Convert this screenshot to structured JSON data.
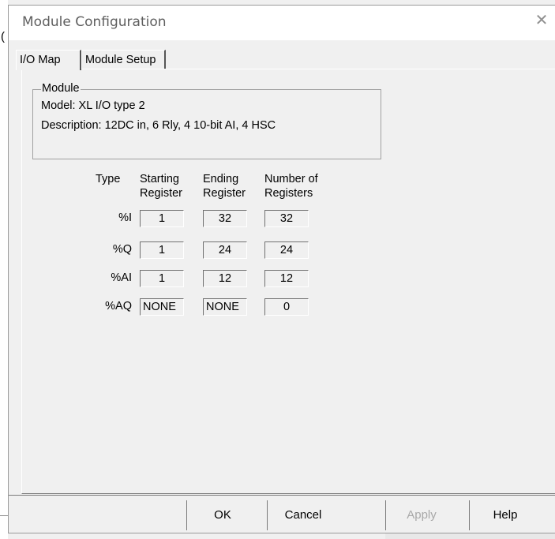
{
  "window": {
    "title": "Module Configuration",
    "close_icon": "close-icon",
    "background_glyph": "("
  },
  "tabs": [
    {
      "label": "I/O Map",
      "active": true
    },
    {
      "label": "Module Setup",
      "active": false
    }
  ],
  "module": {
    "group_label": "Module",
    "model": "Model:  XL I/O type 2",
    "description": "Description:  12DC in, 6 Rly, 4 10-bit AI, 4 HSC"
  },
  "io_table": {
    "headers": {
      "type": "Type",
      "starting": [
        "Starting",
        "Register"
      ],
      "ending": [
        "Ending",
        "Register"
      ],
      "number": [
        "Number of",
        "Registers"
      ]
    },
    "rows": [
      {
        "type": "%I",
        "start": "1",
        "end": "32",
        "count": "32"
      },
      {
        "type": "%Q",
        "start": "1",
        "end": "24",
        "count": "24"
      },
      {
        "type": "%AI",
        "start": "1",
        "end": "12",
        "count": "12"
      },
      {
        "type": "%AQ",
        "start": "NONE",
        "end": "NONE",
        "count": "0"
      }
    ]
  },
  "buttons": {
    "ok": "OK",
    "cancel": "Cancel",
    "apply": "Apply",
    "help": "Help"
  }
}
